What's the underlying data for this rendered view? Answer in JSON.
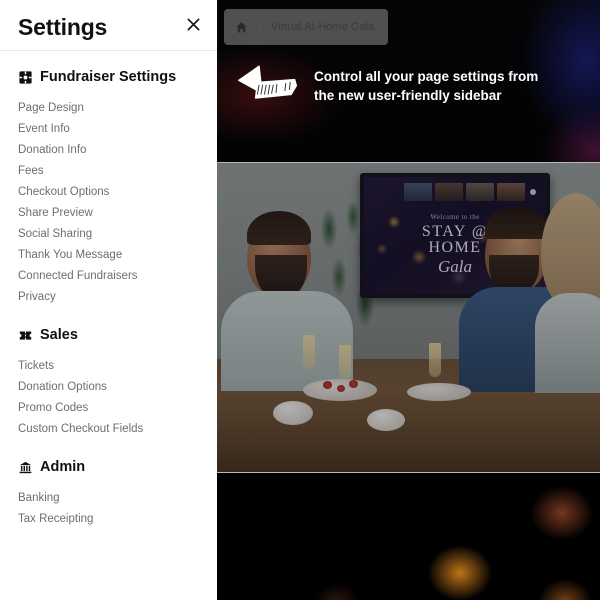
{
  "sidebar": {
    "title": "Settings",
    "close_icon": "close-icon",
    "groups": [
      {
        "label": "Fundraiser Settings",
        "icon": "gear-icon",
        "items": [
          {
            "label": "Page Design"
          },
          {
            "label": "Event Info"
          },
          {
            "label": "Donation Info"
          },
          {
            "label": "Fees"
          },
          {
            "label": "Checkout Options"
          },
          {
            "label": "Share Preview"
          },
          {
            "label": "Social Sharing"
          },
          {
            "label": "Thank You Message"
          },
          {
            "label": "Connected Fundraisers"
          },
          {
            "label": "Privacy"
          }
        ]
      },
      {
        "label": "Sales",
        "icon": "ticket-icon",
        "items": [
          {
            "label": "Tickets"
          },
          {
            "label": "Donation Options"
          },
          {
            "label": "Promo Codes"
          },
          {
            "label": "Custom Checkout Fields"
          }
        ]
      },
      {
        "label": "Admin",
        "icon": "bank-icon",
        "items": [
          {
            "label": "Banking"
          },
          {
            "label": "Tax Receipting"
          }
        ]
      }
    ]
  },
  "content": {
    "breadcrumb": {
      "home_icon": "home-icon",
      "label": "Virtual At-Home Gala"
    },
    "callout": {
      "arrow_icon": "hand-drawn-arrow-left-icon",
      "line1": "Control all your page settings from",
      "line2": "the new user-friendly sidebar"
    },
    "scroll_indicator": "chevron-down-icon",
    "photo": {
      "tv_welcome": "Welcome to the",
      "tv_title_line1": "STAY @",
      "tv_title_line2": "HOME",
      "tv_script": "Gala"
    }
  },
  "colors": {
    "sidebar_bg": "#ffffff",
    "sidebar_title": "#111111",
    "nav_item": "#6e6e6e",
    "content_bg": "#020203",
    "callout_text": "#ffffff",
    "breadcrumb_bg": "rgba(150,150,150,0.52)"
  }
}
